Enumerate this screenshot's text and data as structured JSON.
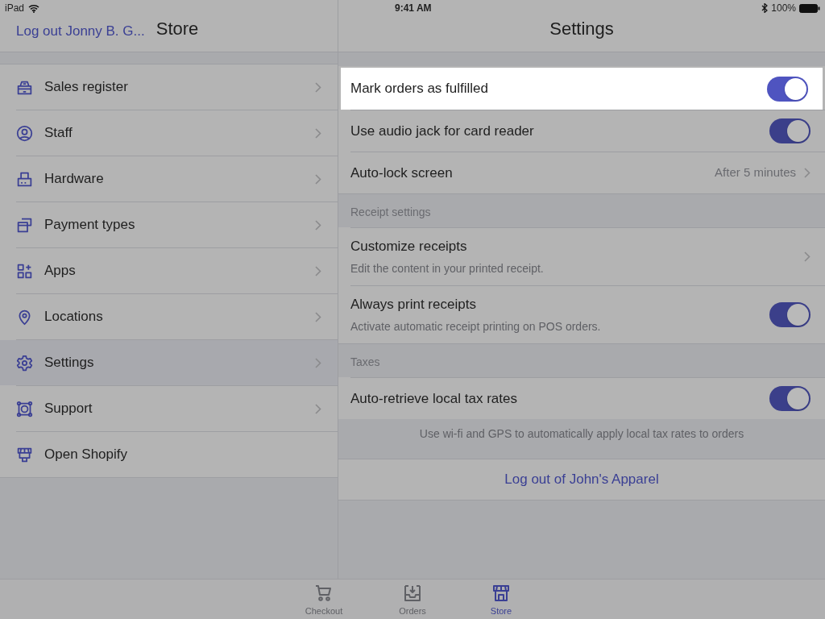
{
  "status_bar": {
    "device": "iPad",
    "time": "9:41 AM",
    "battery": "100%"
  },
  "sidebar": {
    "logout": "Log out Jonny B. G...",
    "title": "Store",
    "items": [
      {
        "label": "Sales register",
        "selected": false,
        "chevron": true
      },
      {
        "label": "Staff",
        "selected": false,
        "chevron": true
      },
      {
        "label": "Hardware",
        "selected": false,
        "chevron": true
      },
      {
        "label": "Payment types",
        "selected": false,
        "chevron": true
      },
      {
        "label": "Apps",
        "selected": false,
        "chevron": true
      },
      {
        "label": "Locations",
        "selected": false,
        "chevron": true
      },
      {
        "label": "Settings",
        "selected": true,
        "chevron": true
      },
      {
        "label": "Support",
        "selected": false,
        "chevron": true
      },
      {
        "label": "Open Shopify",
        "selected": false,
        "chevron": false
      }
    ]
  },
  "settings": {
    "title": "Settings",
    "items": [
      {
        "kind": "toggle",
        "label": "Mark orders as fulfilled",
        "on": true,
        "highlighted": true
      },
      {
        "kind": "toggle",
        "label": "Use audio jack for card reader",
        "on": true,
        "highlighted": false
      },
      {
        "kind": "link",
        "label": "Auto-lock screen",
        "value": "After 5 minutes",
        "highlighted": false
      },
      {
        "kind": "section",
        "label": "Receipt settings"
      },
      {
        "kind": "link",
        "label": "Customize receipts",
        "subtitle": "Edit the content in your printed receipt.",
        "highlighted": false
      },
      {
        "kind": "toggle",
        "label": "Always print receipts",
        "subtitle": "Activate automatic receipt printing on POS orders.",
        "on": true,
        "highlighted": false
      },
      {
        "kind": "section",
        "label": "Taxes"
      },
      {
        "kind": "toggle",
        "label": "Auto-retrieve local tax rates",
        "on": true,
        "highlighted": false
      },
      {
        "kind": "note",
        "label": "Use wi-fi and GPS to automatically apply local tax rates to orders"
      },
      {
        "kind": "button",
        "label": "Log out of John's Apparel"
      }
    ]
  },
  "tab_bar": [
    {
      "label": "Checkout",
      "selected": false
    },
    {
      "label": "Orders",
      "selected": false
    },
    {
      "label": "Store",
      "selected": true
    }
  ]
}
